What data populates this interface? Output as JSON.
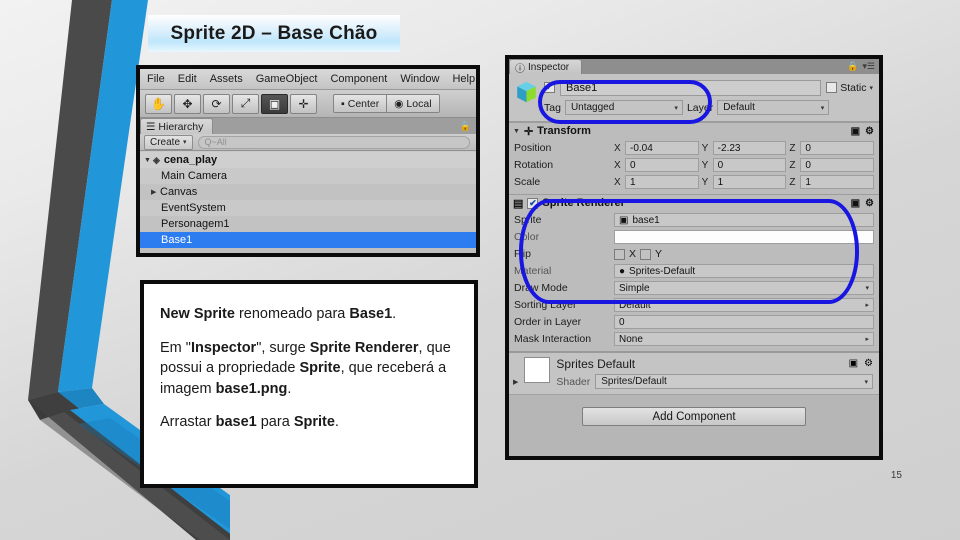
{
  "slide": {
    "title": "Sprite 2D – Base Chão",
    "page_number": "15"
  },
  "unity_editor": {
    "menu": [
      "File",
      "Edit",
      "Assets",
      "GameObject",
      "Component",
      "Window",
      "Help"
    ],
    "toolbar_tools": [
      {
        "name": "hand-tool",
        "glyph": "✋",
        "active": false
      },
      {
        "name": "move-tool",
        "glyph": "✥",
        "active": false
      },
      {
        "name": "rotate-tool",
        "glyph": "⟳",
        "active": false
      },
      {
        "name": "scale-tool",
        "glyph": "⤢",
        "active": false
      },
      {
        "name": "rect-tool",
        "glyph": "▣",
        "active": true
      },
      {
        "name": "transform-tool",
        "glyph": "✛",
        "active": false
      }
    ],
    "pivot_label": "Center",
    "space_label": "Local",
    "hierarchy": {
      "tab_label": "Hierarchy",
      "create_label": "Create",
      "search_placeholder": "Q~All",
      "items": [
        {
          "label": "cena_play",
          "depth": 0,
          "expandable": true,
          "selected": false
        },
        {
          "label": "Main Camera",
          "depth": 1,
          "expandable": false,
          "selected": false
        },
        {
          "label": "Canvas",
          "depth": 1,
          "expandable": true,
          "selected": false
        },
        {
          "label": "EventSystem",
          "depth": 1,
          "expandable": false,
          "selected": false
        },
        {
          "label": "Personagem1",
          "depth": 1,
          "expandable": false,
          "selected": false
        },
        {
          "label": "Base1",
          "depth": 1,
          "expandable": false,
          "selected": true
        }
      ]
    }
  },
  "explanation": {
    "line1_a": "New Sprite",
    "line1_b": " renomeado para ",
    "line1_c": "Base1",
    "line1_d": ".",
    "line2_a": "Em \"",
    "line2_b": "Inspector",
    "line2_c": "\", surge ",
    "line2_d": "Sprite Renderer",
    "line2_e": ", que possui a propriedade ",
    "line2_f": "Sprite",
    "line2_g": ",  que  receberá a imagem  ",
    "line2_h": "base1.png",
    "line2_i": ".",
    "line3_a": "Arrastar  ",
    "line3_b": "base1",
    "line3_c": " para ",
    "line3_d": "Sprite",
    "line3_e": "."
  },
  "inspector": {
    "tab_label": "Inspector",
    "object_name": "Base1",
    "enabled": true,
    "static_label": "Static",
    "tag_label": "Tag",
    "tag_value": "Untagged",
    "layer_label": "Layer",
    "layer_value": "Default",
    "transform": {
      "title": "Transform",
      "rows": [
        {
          "name": "Position",
          "x": "-0.04",
          "y": "-2.23",
          "z": "0"
        },
        {
          "name": "Rotation",
          "x": "0",
          "y": "0",
          "z": "0"
        },
        {
          "name": "Scale",
          "x": "1",
          "y": "1",
          "z": "1"
        }
      ]
    },
    "sprite_renderer": {
      "title": "Sprite Renderer",
      "enabled": true,
      "sprite_label": "Sprite",
      "sprite_value": "base1",
      "color_label": "Color",
      "color_value": "#FFFFFF",
      "flip_label": "Flip",
      "flip_x_label": "X",
      "flip_y_label": "Y",
      "material_label": "Material",
      "material_value": "Sprites-Default",
      "draw_mode_label": "Draw Mode",
      "draw_mode_value": "Simple",
      "sorting_layer_label": "Sorting Layer",
      "sorting_layer_value": "Default",
      "order_in_layer_label": "Order in Layer",
      "order_in_layer_value": "0",
      "mask_interaction_label": "Mask Interaction",
      "mask_interaction_value": "None"
    },
    "material_block": {
      "title": "Sprites Default",
      "shader_label": "Shader",
      "shader_value": "Sprites/Default"
    },
    "add_component_label": "Add Component"
  },
  "colors": {
    "annotation": "#1816E0",
    "selection": "#2D7DF0",
    "accent_blue": "#2196D9",
    "deco_gray": "#4A4A4A",
    "title_blue": "#BFE6FB"
  }
}
